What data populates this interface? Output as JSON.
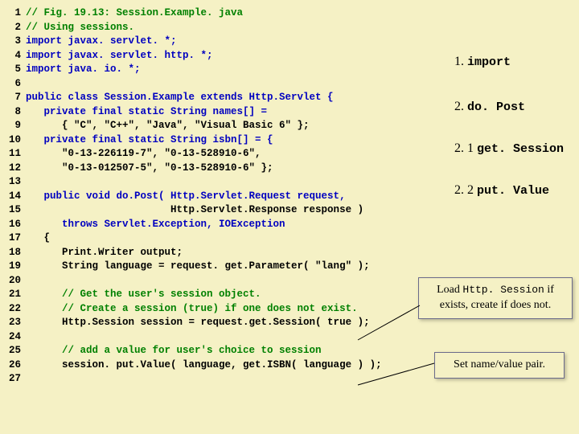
{
  "code": [
    {
      "n": "1",
      "cls": "comment",
      "text": "// Fig. 19.13: Session.Example. java"
    },
    {
      "n": "2",
      "cls": "comment",
      "text": "// Using sessions."
    },
    {
      "n": "3",
      "cls": "keyword",
      "text": "import javax. servlet. *;"
    },
    {
      "n": "4",
      "cls": "keyword",
      "text": "import javax. servlet. http. *;"
    },
    {
      "n": "5",
      "cls": "keyword",
      "text": "import java. io. *;"
    },
    {
      "n": "6",
      "cls": "plain",
      "text": ""
    },
    {
      "n": "7",
      "cls": "keyword",
      "text": "public class Session.Example extends Http.Servlet {"
    },
    {
      "n": "8",
      "cls": "keyword",
      "text": "   private final static String names[] ="
    },
    {
      "n": "9",
      "cls": "plain",
      "text": "      { \"C\", \"C++\", \"Java\", \"Visual Basic 6\" };"
    },
    {
      "n": "10",
      "cls": "keyword",
      "text": "   private final static String isbn[] = {"
    },
    {
      "n": "11",
      "cls": "plain",
      "text": "      \"0-13-226119-7\", \"0-13-528910-6\","
    },
    {
      "n": "12",
      "cls": "plain",
      "text": "      \"0-13-012507-5\", \"0-13-528910-6\" };"
    },
    {
      "n": "13",
      "cls": "plain",
      "text": ""
    },
    {
      "n": "14",
      "cls": "keyword",
      "text": "   public void do.Post( Http.Servlet.Request request,"
    },
    {
      "n": "15",
      "cls": "plain",
      "text": "                        Http.Servlet.Response response )"
    },
    {
      "n": "16",
      "cls": "keyword",
      "text": "      throws Servlet.Exception, IOException"
    },
    {
      "n": "17",
      "cls": "plain",
      "text": "   {"
    },
    {
      "n": "18",
      "cls": "plain",
      "text": "      Print.Writer output;"
    },
    {
      "n": "19",
      "cls": "plain",
      "text": "      String language = request. get.Parameter( \"lang\" );"
    },
    {
      "n": "20",
      "cls": "plain",
      "text": ""
    },
    {
      "n": "21",
      "cls": "comment",
      "text": "      // Get the user's session object."
    },
    {
      "n": "22",
      "cls": "comment",
      "text": "      // Create a session (true) if one does not exist."
    },
    {
      "n": "23",
      "cls": "plain",
      "text": "      Http.Session session = request.get.Session( true );"
    },
    {
      "n": "24",
      "cls": "plain",
      "text": ""
    },
    {
      "n": "25",
      "cls": "comment",
      "text": "      // add a value for user's choice to session"
    },
    {
      "n": "26",
      "cls": "plain",
      "text": "      session. put.Value( language, get.ISBN( language ) );"
    },
    {
      "n": "27",
      "cls": "plain",
      "text": ""
    }
  ],
  "annots": {
    "a1_ord": "1.",
    "a1_kw": "import",
    "a2_ord": "2.",
    "a2_kw": "do. Post",
    "a3_ord": "2. 1",
    "a3_kw": "get. Session",
    "a4_ord": "2. 2",
    "a4_kw": "put. Value"
  },
  "callouts": {
    "c1_pre": "Load ",
    "c1_mono": "Http. Session",
    "c1_post": " if exists, create if does not.",
    "c2": "Set name/value pair."
  }
}
